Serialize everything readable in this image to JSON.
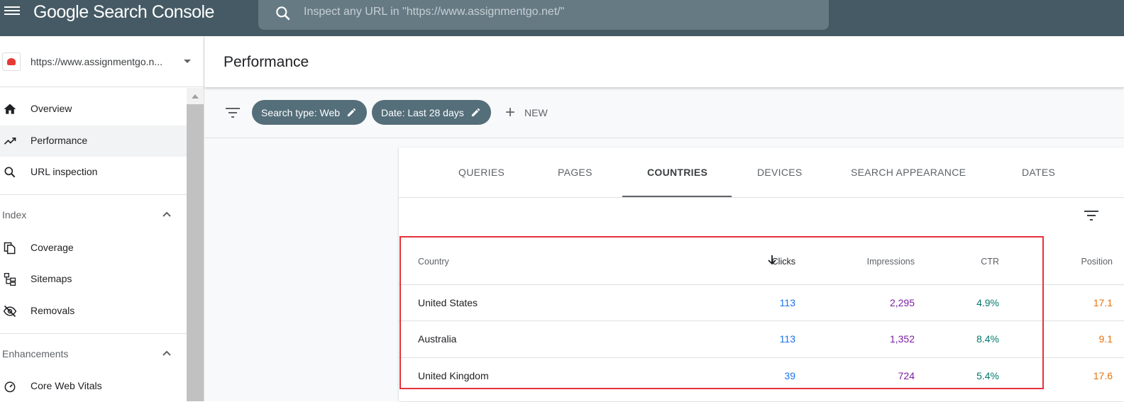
{
  "app": {
    "logo_text": "Google Search Console",
    "search_placeholder": "Inspect any URL in \"https://www.assignmentgo.net/\""
  },
  "sidebar": {
    "property_url": "https://www.assignmentgo.n...",
    "items": [
      {
        "label": "Overview",
        "icon": "home-icon"
      },
      {
        "label": "Performance",
        "icon": "trending-up-icon",
        "active": true
      },
      {
        "label": "URL inspection",
        "icon": "search-icon"
      }
    ],
    "sections": [
      {
        "label": "Index",
        "items": [
          {
            "label": "Coverage",
            "icon": "file-copy-icon"
          },
          {
            "label": "Sitemaps",
            "icon": "sitemap-icon"
          },
          {
            "label": "Removals",
            "icon": "visibility-off-icon"
          }
        ]
      },
      {
        "label": "Enhancements",
        "items": [
          {
            "label": "Core Web Vitals",
            "icon": "speed-gauge-icon"
          }
        ]
      }
    ]
  },
  "main": {
    "title": "Performance",
    "filters": {
      "chips": [
        "Search type: Web",
        "Date: Last 28 days"
      ],
      "new_label": "NEW"
    },
    "tabs": [
      "QUERIES",
      "PAGES",
      "COUNTRIES",
      "DEVICES",
      "SEARCH APPEARANCE",
      "DATES"
    ],
    "active_tab": "COUNTRIES",
    "table": {
      "columns": [
        "Country",
        "Clicks",
        "Impressions",
        "CTR",
        "Position"
      ],
      "sort_column": "Clicks",
      "rows": [
        {
          "country": "United States",
          "clicks": "113",
          "impressions": "2,295",
          "ctr": "4.9%",
          "position": "17.1"
        },
        {
          "country": "Australia",
          "clicks": "113",
          "impressions": "1,352",
          "ctr": "8.4%",
          "position": "9.1"
        },
        {
          "country": "United Kingdom",
          "clicks": "39",
          "impressions": "724",
          "ctr": "5.4%",
          "position": "17.6"
        }
      ]
    }
  },
  "colors": {
    "topbar": "#455a64",
    "chip": "#546e7a",
    "clicks": "#1a73e8",
    "impressions": "#7b1fa2",
    "ctr": "#00796b",
    "position": "#e8710a",
    "highlight_box": "#e5313a"
  }
}
